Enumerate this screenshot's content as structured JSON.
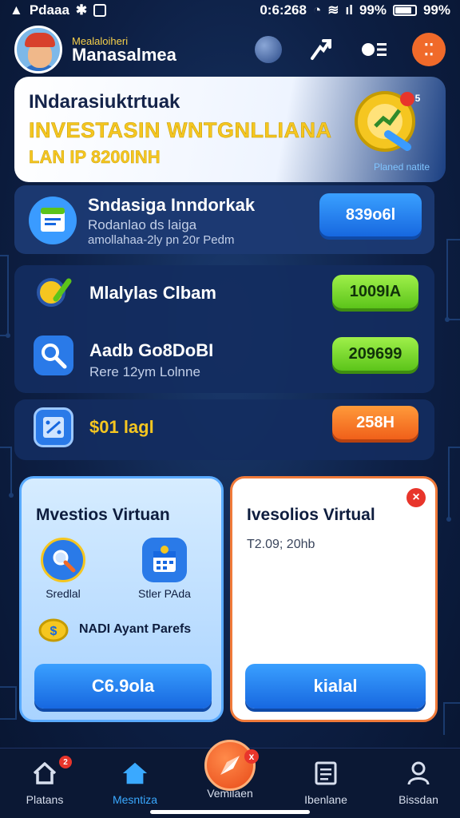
{
  "status_bar": {
    "carrier": "Pdaaa",
    "time": "0:6:268",
    "battery_text": "99%",
    "battery_text2": "99%"
  },
  "header": {
    "small_title": "Mealaloiheri",
    "app_name": "Manasalmea"
  },
  "hero": {
    "title": "INdarasiuktrtuak",
    "subtitle": "INVESTASIN WNTGNLLIANA",
    "amount": "LAN IP 8200INH",
    "caption": "Planed natite",
    "badge": "5"
  },
  "rows": [
    {
      "title": "Sndasiga Inndorkak",
      "sub1": "Rodanlao ds laiga",
      "sub2": "amollahaa-2ly pn 20r Pedm",
      "value": "839o6l",
      "color": "blue"
    },
    {
      "title": "Mlalylas Clbam",
      "value": "1009IA",
      "color": "green"
    },
    {
      "title": "Aadb Go8DoBI",
      "sub1": "Rere 12ym Lolnne",
      "value": "209699",
      "color": "green"
    },
    {
      "title": "$01 lagl",
      "value": "258H",
      "color": "orange"
    }
  ],
  "card_left": {
    "title": "Mvestios Virtuan",
    "feature1": "Sredlal",
    "feature2": "Stler PAda",
    "line": "NADI Ayant Parefs",
    "button": "C6.9ola"
  },
  "card_right": {
    "title": "Ivesolios Virtual",
    "date": "T2.09; 20hb",
    "button": "kialal",
    "close": "×"
  },
  "nav": {
    "items": [
      "Platans",
      "Mesntiza",
      "Vemilaen",
      "Ibenlane",
      "Bissdan"
    ],
    "active": 1,
    "home_badge": "2",
    "fab_badge": "x"
  },
  "colors": {
    "accent_blue": "#1768e0",
    "accent_orange": "#f0601a",
    "accent_green": "#5cc41a",
    "gold": "#f5c620"
  }
}
